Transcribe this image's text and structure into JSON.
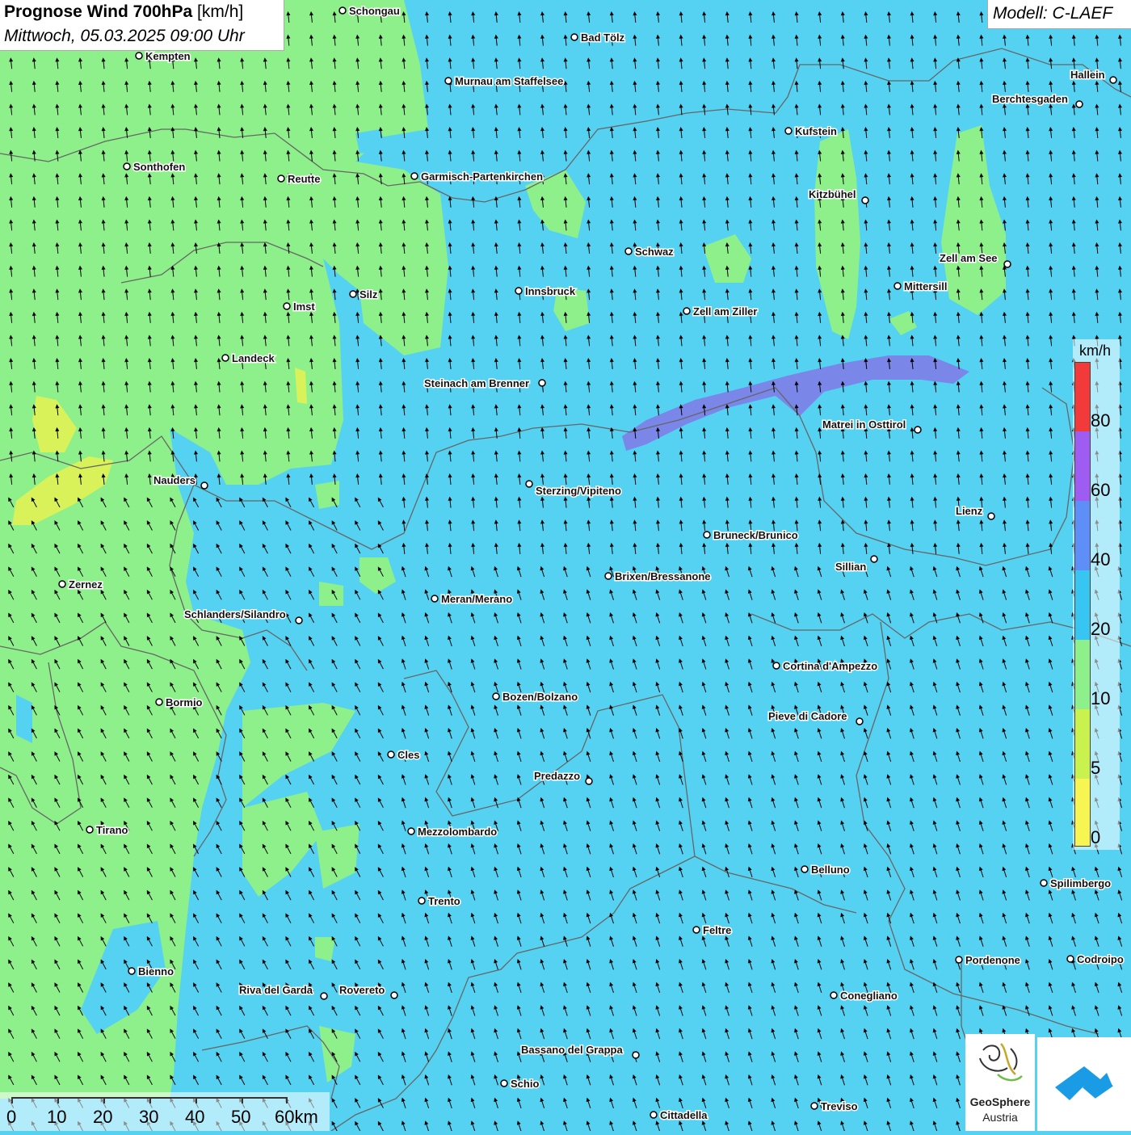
{
  "header": {
    "title_bold": "Prognose Wind 700hPa",
    "title_unit": "[km/h]",
    "subtitle": "Mittwoch, 05.03.2025 09:00 Uhr"
  },
  "model": {
    "label": "Modell: C-LAEF"
  },
  "legend": {
    "unit": "km/h",
    "levels": [
      {
        "label": "0",
        "color": "#f7f552"
      },
      {
        "label": "5",
        "color": "#c9f24e"
      },
      {
        "label": "10",
        "color": "#8ef08a"
      },
      {
        "label": "20",
        "color": "#37c6f2"
      },
      {
        "label": "40",
        "color": "#5e8ef7"
      },
      {
        "label": "60",
        "color": "#9e5cf2"
      },
      {
        "label": "80",
        "color": "#f23a3a"
      }
    ]
  },
  "scale_bar": {
    "labels": [
      "0",
      "10",
      "20",
      "30",
      "40",
      "50",
      "60km"
    ]
  },
  "logos": {
    "geosphere_name": "GeoSphere",
    "geosphere_sub": "Austria",
    "second_logo_icon": "cloud-arrow-icon"
  },
  "cities": [
    {
      "name": "Schongau"
    },
    {
      "name": "Bad Tölz"
    },
    {
      "name": "Kempten"
    },
    {
      "name": "Murnau am Staffelsee"
    },
    {
      "name": "Hallein"
    },
    {
      "name": "Berchtesgaden"
    },
    {
      "name": "Kufstein"
    },
    {
      "name": "Sonthofen"
    },
    {
      "name": "Reutte"
    },
    {
      "name": "Garmisch-Partenkirchen"
    },
    {
      "name": "Kitzbühel"
    },
    {
      "name": "Schwaz"
    },
    {
      "name": "Zell am See"
    },
    {
      "name": "Mittersill"
    },
    {
      "name": "Silz"
    },
    {
      "name": "Innsbruck"
    },
    {
      "name": "Imst"
    },
    {
      "name": "Zell am Ziller"
    },
    {
      "name": "Landeck"
    },
    {
      "name": "Steinach am Brenner"
    },
    {
      "name": "Matrei in Osttirol"
    },
    {
      "name": "Nauders"
    },
    {
      "name": "Sterzing/Vipiteno"
    },
    {
      "name": "Lienz"
    },
    {
      "name": "Bruneck/Brunico"
    },
    {
      "name": "Sillian"
    },
    {
      "name": "Brixen/Bressanone"
    },
    {
      "name": "Zernez"
    },
    {
      "name": "Meran/Merano"
    },
    {
      "name": "Schlanders/Silandro"
    },
    {
      "name": "Cortina d'Ampezzo"
    },
    {
      "name": "Bozen/Bolzano"
    },
    {
      "name": "Bormio"
    },
    {
      "name": "Pieve di Cadore"
    },
    {
      "name": "Cles"
    },
    {
      "name": "Predazzo"
    },
    {
      "name": "Tirano"
    },
    {
      "name": "Mezzolombardo"
    },
    {
      "name": "Belluno"
    },
    {
      "name": "Spilimbergo"
    },
    {
      "name": "Trento"
    },
    {
      "name": "Feltre"
    },
    {
      "name": "Bienno"
    },
    {
      "name": "Pordenone"
    },
    {
      "name": "Codroipo"
    },
    {
      "name": "Riva del Garda"
    },
    {
      "name": "Rovereto"
    },
    {
      "name": "Conegliano"
    },
    {
      "name": "Bassano del Grappa"
    },
    {
      "name": "Schio"
    },
    {
      "name": "Treviso"
    },
    {
      "name": "Cittadella"
    }
  ],
  "colors": {
    "band_10_20": "#8ef08a",
    "band_20_40": "#55d2f2",
    "band_40_60": "#7a86e8",
    "band_5_10": "#d9f25a"
  }
}
